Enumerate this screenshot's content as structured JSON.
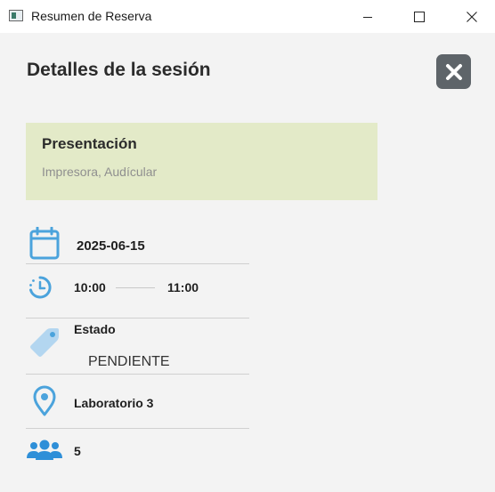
{
  "window": {
    "title": "Resumen de Reserva"
  },
  "header": {
    "title": "Detalles de la sesión"
  },
  "card": {
    "title": "Presentación",
    "subtitle": "Impresora, Audícular"
  },
  "details": {
    "date": "2025-06-15",
    "start_time": "10:00",
    "end_time": "11:00",
    "status_label": "Estado",
    "status_value": "PENDIENTE",
    "location": "Laboratorio 3",
    "attendees": "5"
  },
  "colors": {
    "accent": "#4ba3dc",
    "card_bg": "#e3eac8",
    "close_btn_bg": "#5e6469"
  },
  "icons": {
    "date": "calendar-icon",
    "time": "clock-icon",
    "status": "tag-icon",
    "location": "location-pin-icon",
    "attendees": "group-icon"
  }
}
